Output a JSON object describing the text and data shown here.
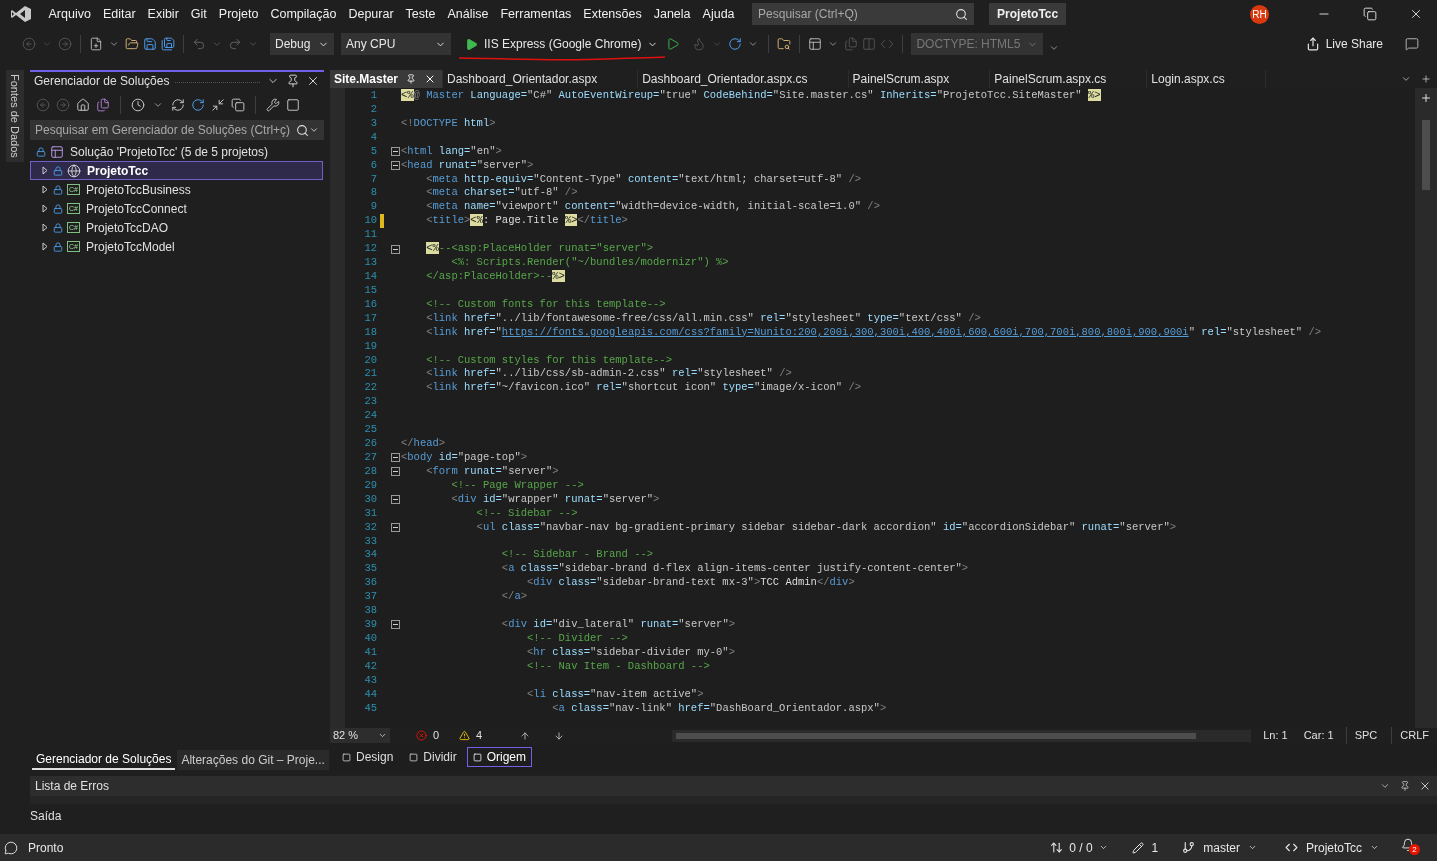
{
  "menu_bar": {
    "items": [
      "Arquivo",
      "Editar",
      "Exibir",
      "Git",
      "Projeto",
      "Compilação",
      "Depurar",
      "Teste",
      "Análise",
      "Ferramentas",
      "Extensões",
      "Janela",
      "Ajuda"
    ],
    "search": {
      "placeholder": "Pesquisar (Ctrl+Q)"
    },
    "project": "ProjetoTcc",
    "avatar": "RH"
  },
  "toolbar": {
    "configuration": "Debug",
    "platform": "Any CPU",
    "run_target": "IIS Express (Google Chrome)",
    "doctype": {
      "value": "DOCTYPE: HTML5",
      "disabled": true
    },
    "live_share": "Live Share"
  },
  "side_tab": "Fontes de Dados",
  "solution_explorer": {
    "title": "Gerenciador de Soluções",
    "search": {
      "placeholder": "Pesquisar em Gerenciador de Soluções (Ctrl+ç)"
    },
    "tree": [
      {
        "label": "Solução 'ProjetoTcc' (5 de 5 projetos)",
        "kind": "solution",
        "selected": false,
        "children": [
          {
            "label": "ProjetoTcc",
            "kind": "web",
            "selected": true,
            "expanded": false
          },
          {
            "label": "ProjetoTccBusiness",
            "kind": "csharp",
            "badge": "C#",
            "selected": false,
            "expanded": false
          },
          {
            "label": "ProjetoTccConnect",
            "kind": "csharp",
            "badge": "C#",
            "selected": false,
            "expanded": false
          },
          {
            "label": "ProjetoTccDAO",
            "kind": "csharp",
            "badge": "C#",
            "selected": false,
            "expanded": false
          },
          {
            "label": "ProjetoTccModel",
            "kind": "csharp",
            "badge": "C#",
            "selected": false,
            "expanded": false
          }
        ]
      }
    ],
    "tabs": [
      {
        "label": "Gerenciador de Soluções",
        "selected": true
      },
      {
        "label": "Alterações do Git – Proje...",
        "selected": false
      }
    ]
  },
  "editor": {
    "tabs": [
      {
        "label": "Site.Master",
        "selected": true
      },
      {
        "label": "Dashboard_Orientador.aspx",
        "selected": false
      },
      {
        "label": "Dashboard_Orientador.aspx.cs",
        "selected": false
      },
      {
        "label": "PainelScrum.aspx",
        "selected": false
      },
      {
        "label": "PainelScrum.aspx.cs",
        "selected": false
      },
      {
        "label": "Login.aspx.cs",
        "selected": false
      }
    ],
    "lines": [
      {
        "number": "1",
        "foldable": false,
        "modified": false,
        "tokens": [
          {
            "kind": "server",
            "text": "<%"
          },
          {
            "kind": "delim",
            "text": "@"
          },
          {
            "kind": "tag",
            "text": " Master"
          },
          {
            "kind": "attr",
            "text": " Language="
          },
          {
            "kind": "str",
            "text": "\"C#\""
          },
          {
            "kind": "attr",
            "text": " AutoEventWireup="
          },
          {
            "kind": "str",
            "text": "\"true\""
          },
          {
            "kind": "attr",
            "text": " CodeBehind="
          },
          {
            "kind": "str",
            "text": "\"Site.master.cs\""
          },
          {
            "kind": "attr",
            "text": " Inherits="
          },
          {
            "kind": "str",
            "text": "\"ProjetoTcc.SiteMaster\" "
          },
          {
            "kind": "server",
            "text": "%>"
          }
        ]
      },
      {
        "number": "2",
        "foldable": false,
        "modified": false
      },
      {
        "number": "3",
        "foldable": false,
        "modified": false,
        "tokens": [
          {
            "kind": "delim",
            "text": "<!"
          },
          {
            "kind": "tag",
            "text": "DOCTYPE"
          },
          {
            "kind": "attr",
            "text": " html"
          },
          {
            "kind": "delim",
            "text": ">"
          }
        ]
      },
      {
        "number": "4",
        "foldable": false,
        "modified": false
      },
      {
        "number": "5",
        "foldable": true,
        "modified": false,
        "tokens": [
          {
            "kind": "delim",
            "text": "<"
          },
          {
            "kind": "tag",
            "text": "html"
          },
          {
            "kind": "attr",
            "text": " lang="
          },
          {
            "kind": "str",
            "text": "\"en\""
          },
          {
            "kind": "delim",
            "text": ">"
          }
        ]
      },
      {
        "number": "6",
        "foldable": true,
        "modified": false,
        "tokens": [
          {
            "kind": "delim",
            "text": "<"
          },
          {
            "kind": "tag",
            "text": "head"
          },
          {
            "kind": "attr",
            "text": " runat="
          },
          {
            "kind": "str",
            "text": "\"server\""
          },
          {
            "kind": "delim",
            "text": ">"
          }
        ]
      },
      {
        "number": "7",
        "foldable": false,
        "modified": false,
        "tokens": [
          {
            "kind": "delim",
            "text": "    <"
          },
          {
            "kind": "tag",
            "text": "meta"
          },
          {
            "kind": "attr",
            "text": " http-equiv="
          },
          {
            "kind": "str",
            "text": "\"Content-Type\""
          },
          {
            "kind": "attr",
            "text": " content="
          },
          {
            "kind": "str",
            "text": "\"text/html; charset=utf-8\""
          },
          {
            "kind": "delim",
            "text": " />"
          }
        ]
      },
      {
        "number": "8",
        "foldable": false,
        "modified": false,
        "tokens": [
          {
            "kind": "delim",
            "text": "    <"
          },
          {
            "kind": "tag",
            "text": "meta"
          },
          {
            "kind": "attr",
            "text": " charset="
          },
          {
            "kind": "str",
            "text": "\"utf-8\""
          },
          {
            "kind": "delim",
            "text": " />"
          }
        ]
      },
      {
        "number": "9",
        "foldable": false,
        "modified": false,
        "tokens": [
          {
            "kind": "delim",
            "text": "    <"
          },
          {
            "kind": "tag",
            "text": "meta"
          },
          {
            "kind": "attr",
            "text": " name="
          },
          {
            "kind": "str",
            "text": "\"viewport\""
          },
          {
            "kind": "attr",
            "text": " content="
          },
          {
            "kind": "str",
            "text": "\"width=device-width, initial-scale=1.0\""
          },
          {
            "kind": "delim",
            "text": " />"
          }
        ]
      },
      {
        "number": "10",
        "foldable": false,
        "modified": true,
        "tokens": [
          {
            "kind": "delim",
            "text": "    <"
          },
          {
            "kind": "tag",
            "text": "title"
          },
          {
            "kind": "delim",
            "text": ">"
          },
          {
            "kind": "server",
            "text": "<%"
          },
          {
            "kind": "plain",
            "text": ": Page.Title "
          },
          {
            "kind": "server",
            "text": "%>"
          },
          {
            "kind": "delim",
            "text": "</"
          },
          {
            "kind": "tag",
            "text": "title"
          },
          {
            "kind": "delim",
            "text": ">"
          }
        ]
      },
      {
        "number": "11",
        "foldable": false,
        "modified": false
      },
      {
        "number": "12",
        "foldable": true,
        "modified": false,
        "tokens": [
          {
            "kind": "server",
            "text": "    <%"
          },
          {
            "kind": "comment",
            "text": "--<asp:PlaceHolder runat=\"server\">"
          }
        ]
      },
      {
        "number": "13",
        "foldable": false,
        "modified": false,
        "tokens": [
          {
            "kind": "comment",
            "text": "        <%: Scripts.Render(\"~/bundles/modernizr\") %>"
          }
        ]
      },
      {
        "number": "14",
        "foldable": false,
        "modified": false,
        "tokens": [
          {
            "kind": "comment",
            "text": "    </asp:PlaceHolder>--"
          },
          {
            "kind": "server",
            "text": "%>"
          }
        ]
      },
      {
        "number": "15",
        "foldable": false,
        "modified": false
      },
      {
        "number": "16",
        "foldable": false,
        "modified": false,
        "tokens": [
          {
            "kind": "comment",
            "text": "    <!-- Custom fonts for this template-->"
          }
        ]
      },
      {
        "number": "17",
        "foldable": false,
        "modified": false,
        "tokens": [
          {
            "kind": "delim",
            "text": "    <"
          },
          {
            "kind": "tag",
            "text": "link"
          },
          {
            "kind": "attr",
            "text": " href="
          },
          {
            "kind": "str",
            "text": "\"../lib/fontawesome-free/css/all.min.css\""
          },
          {
            "kind": "attr",
            "text": " rel="
          },
          {
            "kind": "str",
            "text": "\"stylesheet\""
          },
          {
            "kind": "attr",
            "text": " type="
          },
          {
            "kind": "str",
            "text": "\"text/css\""
          },
          {
            "kind": "delim",
            "text": " />"
          }
        ]
      },
      {
        "number": "18",
        "foldable": false,
        "modified": false,
        "tokens": [
          {
            "kind": "delim",
            "text": "    <"
          },
          {
            "kind": "tag",
            "text": "link"
          },
          {
            "kind": "attr",
            "text": " href="
          },
          {
            "kind": "str",
            "text": "\""
          },
          {
            "kind": "link",
            "text": "https://fonts.googleapis.com/css?family=Nunito:200,200i,300,300i,400,400i,600,600i,700,700i,800,800i,900,900i"
          },
          {
            "kind": "str",
            "text": "\""
          },
          {
            "kind": "attr",
            "text": " rel="
          },
          {
            "kind": "str",
            "text": "\"stylesheet\""
          },
          {
            "kind": "delim",
            "text": " />"
          }
        ]
      },
      {
        "number": "19",
        "foldable": false,
        "modified": false
      },
      {
        "number": "20",
        "foldable": false,
        "modified": false,
        "tokens": [
          {
            "kind": "comment",
            "text": "    <!-- Custom styles for this template-->"
          }
        ]
      },
      {
        "number": "21",
        "foldable": false,
        "modified": false,
        "tokens": [
          {
            "kind": "delim",
            "text": "    <"
          },
          {
            "kind": "tag",
            "text": "link"
          },
          {
            "kind": "attr",
            "text": " href="
          },
          {
            "kind": "str",
            "text": "\"../lib/css/sb-admin-2.css\""
          },
          {
            "kind": "attr",
            "text": " rel="
          },
          {
            "kind": "str",
            "text": "\"stylesheet\""
          },
          {
            "kind": "delim",
            "text": " />"
          }
        ]
      },
      {
        "number": "22",
        "foldable": false,
        "modified": false,
        "tokens": [
          {
            "kind": "delim",
            "text": "    <"
          },
          {
            "kind": "tag",
            "text": "link"
          },
          {
            "kind": "attr",
            "text": " href="
          },
          {
            "kind": "str",
            "text": "\"~/favicon.ico\""
          },
          {
            "kind": "attr",
            "text": " rel="
          },
          {
            "kind": "str",
            "text": "\"shortcut icon\""
          },
          {
            "kind": "attr",
            "text": " type="
          },
          {
            "kind": "str",
            "text": "\"image/x-icon\""
          },
          {
            "kind": "delim",
            "text": " />"
          }
        ]
      },
      {
        "number": "23",
        "foldable": false,
        "modified": false
      },
      {
        "number": "24",
        "foldable": false,
        "modified": false
      },
      {
        "number": "25",
        "foldable": false,
        "modified": false
      },
      {
        "number": "26",
        "foldable": false,
        "modified": false,
        "tokens": [
          {
            "kind": "delim",
            "text": "</"
          },
          {
            "kind": "tag",
            "text": "head"
          },
          {
            "kind": "delim",
            "text": ">"
          }
        ]
      },
      {
        "number": "27",
        "foldable": true,
        "modified": false,
        "tokens": [
          {
            "kind": "delim",
            "text": "<"
          },
          {
            "kind": "tag",
            "text": "body"
          },
          {
            "kind": "attr",
            "text": " id="
          },
          {
            "kind": "str",
            "text": "\"page-top\""
          },
          {
            "kind": "delim",
            "text": ">"
          }
        ]
      },
      {
        "number": "28",
        "foldable": true,
        "modified": false,
        "tokens": [
          {
            "kind": "delim",
            "text": "    <"
          },
          {
            "kind": "tag",
            "text": "form"
          },
          {
            "kind": "attr",
            "text": " runat="
          },
          {
            "kind": "str",
            "text": "\"server\""
          },
          {
            "kind": "delim",
            "text": ">"
          }
        ]
      },
      {
        "number": "29",
        "foldable": false,
        "modified": false,
        "tokens": [
          {
            "kind": "comment",
            "text": "        <!-- Page Wrapper -->"
          }
        ]
      },
      {
        "number": "30",
        "foldable": true,
        "modified": false,
        "tokens": [
          {
            "kind": "delim",
            "text": "        <"
          },
          {
            "kind": "tag",
            "text": "div"
          },
          {
            "kind": "attr",
            "text": " id="
          },
          {
            "kind": "str",
            "text": "\"wrapper\""
          },
          {
            "kind": "attr",
            "text": " runat="
          },
          {
            "kind": "str",
            "text": "\"server\""
          },
          {
            "kind": "delim",
            "text": ">"
          }
        ]
      },
      {
        "number": "31",
        "foldable": false,
        "modified": false,
        "tokens": [
          {
            "kind": "comment",
            "text": "            <!-- Sidebar -->"
          }
        ]
      },
      {
        "number": "32",
        "foldable": true,
        "modified": false,
        "tokens": [
          {
            "kind": "delim",
            "text": "            <"
          },
          {
            "kind": "tag",
            "text": "ul"
          },
          {
            "kind": "attr",
            "text": " class="
          },
          {
            "kind": "str",
            "text": "\"navbar-nav bg-gradient-primary sidebar sidebar-dark accordion\""
          },
          {
            "kind": "attr",
            "text": " id="
          },
          {
            "kind": "str",
            "text": "\"accordionSidebar\""
          },
          {
            "kind": "attr",
            "text": " runat="
          },
          {
            "kind": "str",
            "text": "\"server\""
          },
          {
            "kind": "delim",
            "text": ">"
          }
        ]
      },
      {
        "number": "33",
        "foldable": false,
        "modified": false
      },
      {
        "number": "34",
        "foldable": false,
        "modified": false,
        "tokens": [
          {
            "kind": "comment",
            "text": "                <!-- Sidebar - Brand -->"
          }
        ]
      },
      {
        "number": "35",
        "foldable": false,
        "modified": false,
        "tokens": [
          {
            "kind": "delim",
            "text": "                <"
          },
          {
            "kind": "tag",
            "text": "a"
          },
          {
            "kind": "attr",
            "text": " class="
          },
          {
            "kind": "str",
            "text": "\"sidebar-brand d-flex align-items-center justify-content-center\""
          },
          {
            "kind": "delim",
            "text": ">"
          }
        ]
      },
      {
        "number": "36",
        "foldable": false,
        "modified": false,
        "tokens": [
          {
            "kind": "delim",
            "text": "                    <"
          },
          {
            "kind": "tag",
            "text": "div"
          },
          {
            "kind": "attr",
            "text": " class="
          },
          {
            "kind": "str",
            "text": "\"sidebar-brand-text mx-3\""
          },
          {
            "kind": "delim",
            "text": ">"
          },
          {
            "kind": "plain",
            "text": "TCC Admin"
          },
          {
            "kind": "delim",
            "text": "</"
          },
          {
            "kind": "tag",
            "text": "div"
          },
          {
            "kind": "delim",
            "text": ">"
          }
        ]
      },
      {
        "number": "37",
        "foldable": false,
        "modified": false,
        "tokens": [
          {
            "kind": "delim",
            "text": "                </"
          },
          {
            "kind": "tag",
            "text": "a"
          },
          {
            "kind": "delim",
            "text": ">"
          }
        ]
      },
      {
        "number": "38",
        "foldable": false,
        "modified": false
      },
      {
        "number": "39",
        "foldable": true,
        "modified": false,
        "tokens": [
          {
            "kind": "delim",
            "text": "                <"
          },
          {
            "kind": "tag",
            "text": "div"
          },
          {
            "kind": "attr",
            "text": " id="
          },
          {
            "kind": "str",
            "text": "\"div_lateral\""
          },
          {
            "kind": "attr",
            "text": " runat="
          },
          {
            "kind": "str",
            "text": "\"server\""
          },
          {
            "kind": "delim",
            "text": ">"
          }
        ]
      },
      {
        "number": "40",
        "foldable": false,
        "modified": false,
        "tokens": [
          {
            "kind": "comment",
            "text": "                    <!-- Divider -->"
          }
        ]
      },
      {
        "number": "41",
        "foldable": false,
        "modified": false,
        "tokens": [
          {
            "kind": "delim",
            "text": "                    <"
          },
          {
            "kind": "tag",
            "text": "hr"
          },
          {
            "kind": "attr",
            "text": " class="
          },
          {
            "kind": "str",
            "text": "\"sidebar-divider my-0\""
          },
          {
            "kind": "delim",
            "text": ">"
          }
        ]
      },
      {
        "number": "42",
        "foldable": false,
        "modified": false,
        "tokens": [
          {
            "kind": "comment",
            "text": "                    <!-- Nav Item - Dashboard -->"
          }
        ]
      },
      {
        "number": "43",
        "foldable": false,
        "modified": false
      },
      {
        "number": "44",
        "foldable": false,
        "modified": false,
        "tokens": [
          {
            "kind": "delim",
            "text": "                    <"
          },
          {
            "kind": "tag",
            "text": "li"
          },
          {
            "kind": "attr",
            "text": " class="
          },
          {
            "kind": "str",
            "text": "\"nav-item active\""
          },
          {
            "kind": "delim",
            "text": ">"
          }
        ]
      },
      {
        "number": "45",
        "foldable": false,
        "modified": false,
        "tokens": [
          {
            "kind": "delim",
            "text": "                        <"
          },
          {
            "kind": "tag",
            "text": "a"
          },
          {
            "kind": "attr",
            "text": " class="
          },
          {
            "kind": "str",
            "text": "\"nav-link\""
          },
          {
            "kind": "attr",
            "text": " href="
          },
          {
            "kind": "str",
            "text": "\"DashBoard_Orientador.aspx\""
          },
          {
            "kind": "delim",
            "text": ">"
          }
        ]
      }
    ],
    "zoom": "82 %",
    "errors": "0",
    "warnings": "4",
    "line": "Ln: 1",
    "column": "Car: 1",
    "indent": "SPC",
    "line_ending": "CRLF",
    "views": [
      {
        "label": "Design",
        "selected": false
      },
      {
        "label": "Dividir",
        "selected": false
      },
      {
        "label": "Origem",
        "selected": true
      }
    ]
  },
  "error_list": {
    "title": "Lista de Erros"
  },
  "output_tab": "Saída",
  "status_bar": {
    "text": "Pronto",
    "changes": "0 / 0",
    "edits": "1",
    "branch": "master",
    "repository": "ProjetoTcc",
    "notifications": "2"
  }
}
